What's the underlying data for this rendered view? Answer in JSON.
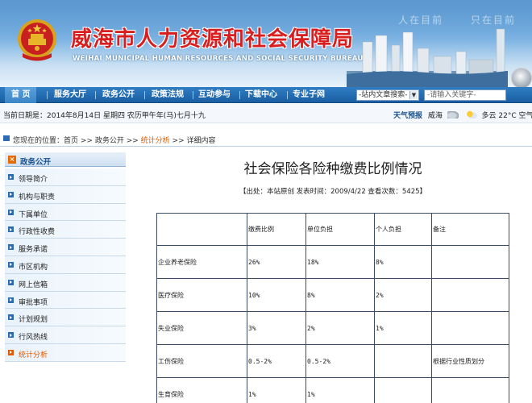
{
  "header": {
    "title_cn": "威海市人力资源和社会保障局",
    "title_en": "WEIHAI MUNICIPAL HUMAN RESOURCES AND SOCIAL SECURITY BUREAU",
    "top_links": [
      "人在目前",
      "只在目前"
    ]
  },
  "nav": {
    "items": [
      "首 页",
      "服务大厅",
      "政务公开",
      "政策法规",
      "互动参与",
      "下载中心",
      "专业子网"
    ],
    "search_select": "-站内文章搜索-",
    "search_placeholder": "-请输入关键字-"
  },
  "datebar": {
    "date": "当前日期是：2014年8月14日 星期四 农历甲午年(马)七月十九",
    "weather_label": "天气预报",
    "city": "威海",
    "condition": "多云 22°C 空气"
  },
  "breadcrumb": {
    "prefix": "您现在的位置：",
    "home": "首页",
    "sep1": " >> ",
    "section": "政务公开",
    "sep2": " >> ",
    "current": "统计分析",
    "sep3": " >> ",
    "page": "详细内容"
  },
  "sidebar": {
    "heading": "政务公开",
    "items": [
      {
        "label": "领导简介",
        "active": false
      },
      {
        "label": "机构与职责",
        "active": false
      },
      {
        "label": "下属单位",
        "active": false
      },
      {
        "label": "行政性收费",
        "active": false
      },
      {
        "label": "服务承诺",
        "active": false
      },
      {
        "label": "市区机构",
        "active": false
      },
      {
        "label": "网上信箱",
        "active": false
      },
      {
        "label": "审批事项",
        "active": false
      },
      {
        "label": "计划规划",
        "active": false
      },
      {
        "label": "行风热线",
        "active": false
      },
      {
        "label": "统计分析",
        "active": true
      }
    ]
  },
  "article": {
    "title": "社会保险各险种缴费比例情况",
    "meta": "【出处：本站原创  发表时间：2009/4/22  查看次数：5425】",
    "table": {
      "headers": [
        "",
        "缴费比例",
        "单位负担",
        "个人负担",
        "备注"
      ],
      "rows": [
        [
          "企业养老保险",
          "26%",
          "18%",
          "8%",
          ""
        ],
        [
          "医疗保险",
          "10%",
          "8%",
          "2%",
          ""
        ],
        [
          "失业保险",
          "3%",
          "2%",
          "1%",
          ""
        ],
        [
          "工伤保险",
          "0.5-2%",
          "0.5-2%",
          "",
          "根据行业性质划分"
        ],
        [
          "生育保险",
          "1%",
          "1%",
          "",
          ""
        ]
      ]
    }
  },
  "colors": {
    "nav_blue": "#1a5ea3",
    "title_red": "#d81e1e",
    "highlight_orange": "#e05a00"
  }
}
